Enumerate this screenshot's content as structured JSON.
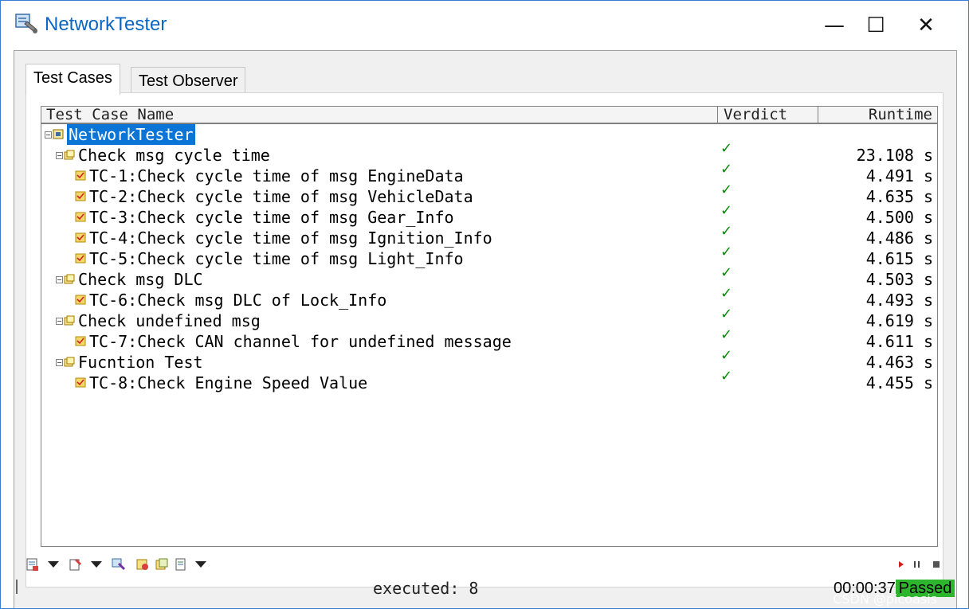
{
  "window": {
    "title": "NetworkTester"
  },
  "tabs": [
    {
      "label": "Test Cases",
      "active": true
    },
    {
      "label": "Test Observer",
      "active": false
    }
  ],
  "columns": {
    "name": "Test Case Name",
    "verdict": "Verdict",
    "runtime": "Runtime"
  },
  "tree": [
    {
      "label": "NetworkTester",
      "level": 0,
      "verdict": "",
      "runtime": "",
      "selected": true
    },
    {
      "label": "Check msg cycle time",
      "level": 1,
      "verdict": "✓",
      "runtime": "23.108 s"
    },
    {
      "label": "TC-1:Check cycle time of msg EngineData",
      "level": 2,
      "verdict": "✓",
      "runtime": "4.491 s"
    },
    {
      "label": "TC-2:Check cycle time of msg VehicleData",
      "level": 2,
      "verdict": "✓",
      "runtime": "4.635 s"
    },
    {
      "label": "TC-3:Check cycle time of msg Gear_Info",
      "level": 2,
      "verdict": "✓",
      "runtime": "4.500 s"
    },
    {
      "label": "TC-4:Check cycle time of msg Ignition_Info",
      "level": 2,
      "verdict": "✓",
      "runtime": "4.486 s"
    },
    {
      "label": "TC-5:Check cycle time of msg Light_Info",
      "level": 2,
      "verdict": "✓",
      "runtime": "4.615 s"
    },
    {
      "label": "Check msg DLC",
      "level": 1,
      "verdict": "✓",
      "runtime": "4.503 s"
    },
    {
      "label": "TC-6:Check msg DLC of Lock_Info",
      "level": 2,
      "verdict": "✓",
      "runtime": "4.493 s"
    },
    {
      "label": "Check undefined msg",
      "level": 1,
      "verdict": "✓",
      "runtime": "4.619 s"
    },
    {
      "label": "TC-7:Check CAN channel for undefined message",
      "level": 2,
      "verdict": "✓",
      "runtime": "4.611 s"
    },
    {
      "label": "Fucntion Test",
      "level": 1,
      "verdict": "✓",
      "runtime": "4.463 s"
    },
    {
      "label": "TC-8:Check Engine Speed Value",
      "level": 2,
      "verdict": "✓",
      "runtime": "4.455 s"
    }
  ],
  "status": {
    "executed": "executed: 8",
    "elapsed": "00:00:37",
    "result": "Passed"
  },
  "watermark": "CSDN @picoasis",
  "colors": {
    "selection": "#0a75d6",
    "passed": "#2db52d",
    "check": "#0a8a0a",
    "title": "#0a66c2"
  },
  "icons": {
    "app": "network-tester-icon",
    "minimize": "minimize-icon",
    "maximize": "maximize-icon",
    "close": "close-icon",
    "root": "test-environment-icon",
    "group": "test-group-icon",
    "testcase": "test-case-icon",
    "verdict": "check-icon",
    "play": "play-icon",
    "pause": "pause-icon",
    "stop": "stop-icon"
  }
}
